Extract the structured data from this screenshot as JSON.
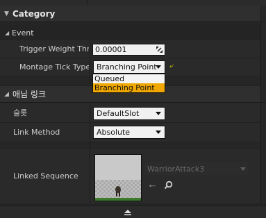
{
  "category": {
    "title": "Category"
  },
  "event": {
    "title": "Event",
    "trigger_weight": {
      "label": "Trigger Weight Thre",
      "value": "0.00001"
    },
    "montage_tick_type": {
      "label": "Montage Tick Type",
      "value": "Branching Point",
      "options": [
        "Queued",
        "Branching Point"
      ],
      "reset_icon": "reset-arrow-icon"
    }
  },
  "anim_link": {
    "title": "애님 링크",
    "slot": {
      "label": "슬롯",
      "value": "DefaultSlot"
    },
    "link_method": {
      "label": "Link Method",
      "value": "Absolute"
    },
    "linked_sequence": {
      "label": "Linked Sequence",
      "asset": "WarriorAttack3"
    }
  },
  "colors": {
    "accent": "#f0a800",
    "reset": "#d7d000"
  }
}
